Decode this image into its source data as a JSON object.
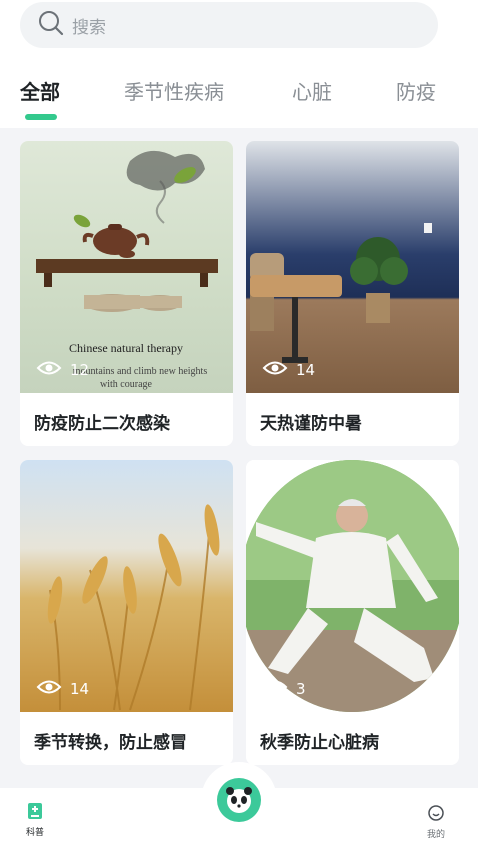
{
  "search": {
    "placeholder": "搜索"
  },
  "tabs": [
    {
      "label": "全部",
      "active": true
    },
    {
      "label": "季节性疾病",
      "active": false
    },
    {
      "label": "心脏",
      "active": false
    },
    {
      "label": "防疫",
      "active": false
    }
  ],
  "cards": [
    {
      "title": "防疫防止二次感染",
      "views": "12",
      "image_text": "Chinese natural therapy",
      "image_subtext_1": "mountains and climb new heights",
      "image_subtext_2": "with courage"
    },
    {
      "title": "天热谨防中暑",
      "views": "14"
    },
    {
      "title": "季节转换，防止感冒",
      "views": "14"
    },
    {
      "title": "秋季防止心脏病",
      "views": "3"
    }
  ],
  "bottom_nav": {
    "left_label": "科普",
    "right_label": "我的"
  },
  "colors": {
    "accent": "#33c98d",
    "center_button": "#3cc99a"
  }
}
